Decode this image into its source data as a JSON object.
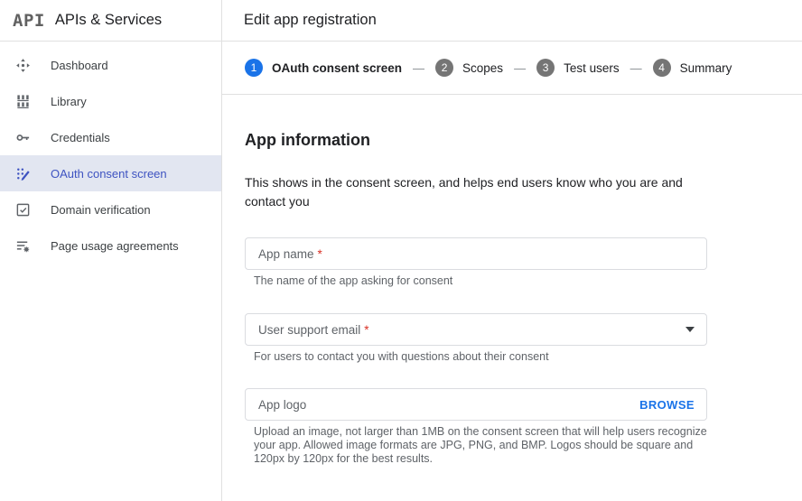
{
  "colors": {
    "accent_blue": "#1a73e8",
    "selected_nav_blue": "#3e53c1",
    "selected_nav_bg": "#e2e6f1",
    "required_red": "#d93025",
    "input_border": "#dadce0",
    "text_primary": "#202124",
    "text_secondary": "#5f6368",
    "step_inactive_gray": "#757575"
  },
  "sidebar": {
    "logo": "API",
    "title": "APIs & Services",
    "items": [
      {
        "label": "Dashboard",
        "icon": "dashboard-icon",
        "selected": false
      },
      {
        "label": "Library",
        "icon": "library-icon",
        "selected": false
      },
      {
        "label": "Credentials",
        "icon": "key-icon",
        "selected": false
      },
      {
        "label": "OAuth consent screen",
        "icon": "oauth-consent-icon",
        "selected": true
      },
      {
        "label": "Domain verification",
        "icon": "domain-verification-icon",
        "selected": false
      },
      {
        "label": "Page usage agreements",
        "icon": "page-usage-icon",
        "selected": false
      }
    ]
  },
  "header": {
    "title": "Edit app registration"
  },
  "stepper": {
    "separator": "—",
    "steps": [
      {
        "number": "1",
        "label": "OAuth consent screen",
        "active": true
      },
      {
        "number": "2",
        "label": "Scopes",
        "active": false
      },
      {
        "number": "3",
        "label": "Test users",
        "active": false
      },
      {
        "number": "4",
        "label": "Summary",
        "active": false
      }
    ]
  },
  "main": {
    "section_title": "App information",
    "section_description": "This shows in the consent screen, and helps end users know who you are and contact you",
    "fields": [
      {
        "label": "App name",
        "required": "*",
        "helper": "The name of the app asking for consent"
      },
      {
        "label": "User support email",
        "required": "*",
        "helper": "For users to contact you with questions about their consent"
      },
      {
        "label": "App logo",
        "action": "BROWSE",
        "helper": "Upload an image, not larger than 1MB on the consent screen that will help users recognize your app. Allowed image formats are JPG, PNG, and BMP. Logos should be square and 120px by 120px for the best results."
      }
    ]
  }
}
